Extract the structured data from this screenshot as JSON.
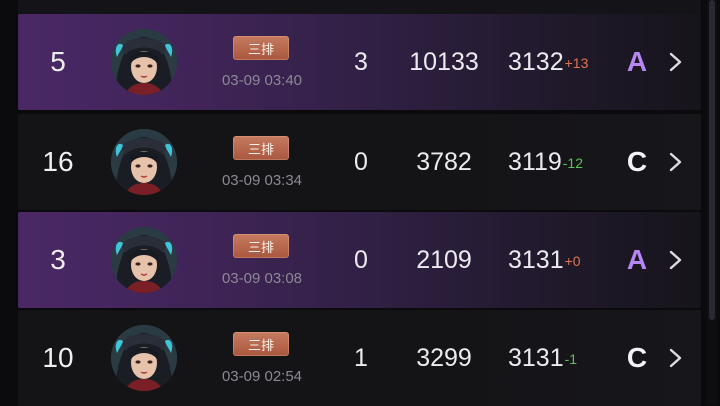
{
  "rows": [
    {
      "rank": "5",
      "mode": "三排",
      "time": "03-09 03:40",
      "kills": "3",
      "score": "10133",
      "rating": "3132",
      "delta": "+13",
      "delta_dir": "up",
      "grade": "A",
      "grade_color": "#b587f2",
      "highlight": true
    },
    {
      "rank": "16",
      "mode": "三排",
      "time": "03-09 03:34",
      "kills": "0",
      "score": "3782",
      "rating": "3119",
      "delta": "-12",
      "delta_dir": "down",
      "grade": "C",
      "grade_color": "#f4f2f5",
      "highlight": false
    },
    {
      "rank": "3",
      "mode": "三排",
      "time": "03-09 03:08",
      "kills": "0",
      "score": "2109",
      "rating": "3131",
      "delta": "+0",
      "delta_dir": "up",
      "grade": "A",
      "grade_color": "#b587f2",
      "highlight": true
    },
    {
      "rank": "10",
      "mode": "三排",
      "time": "03-09 02:54",
      "kills": "1",
      "score": "3299",
      "rating": "3131",
      "delta": "-1",
      "delta_dir": "down",
      "grade": "C",
      "grade_color": "#f4f2f5",
      "highlight": false
    }
  ],
  "colors": {
    "highlight_row": "#4a2865",
    "dark_row": "#141316",
    "delta_up": "#e2734f",
    "delta_down": "#5fc05b",
    "grade_a": "#b587f2",
    "grade_c": "#f4f2f5"
  },
  "icons": {
    "avatar": "hero-avatar",
    "row_action": "chevron-right-icon"
  }
}
